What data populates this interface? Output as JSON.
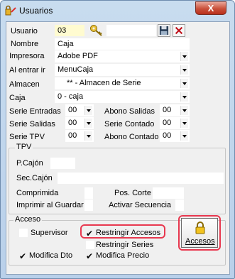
{
  "window": {
    "title": "Usuarios",
    "close_glyph": "X"
  },
  "top": {
    "usuario_label": "Usuario",
    "usuario_value": "03",
    "nombre_label": "Nombre",
    "nombre_value": "Caja",
    "impresora_label": "Impresora",
    "impresora_value": "Adobe PDF",
    "alentrar_label": "Al entrar ir",
    "alentrar_value": "MenuCaja",
    "almacen_label": "Almacen",
    "almacen_value": "** - Almacen de Serie",
    "caja_label": "Caja",
    "caja_value": "0 - caja"
  },
  "series": {
    "entradas_label": "Serie Entradas",
    "entradas_value": "00",
    "abono_salidas_label": "Abono Salidas",
    "abono_salidas_value": "00",
    "salidas_label": "Serie Salidas",
    "salidas_value": "00",
    "contado_label": "Serie Contado",
    "contado_value": "00",
    "tpv_label": "Serie TPV",
    "tpv_value": "00",
    "abono_contado_label": "Abono Contado",
    "abono_contado_value": "00"
  },
  "tpv": {
    "group_title": "TPV",
    "pcajon_label": "P.Cajón",
    "seccajon_label": "Sec.Cajón",
    "comprimida_label": "Comprimida",
    "pos_corte_label": "Pos. Corte",
    "imprimir_label": "Imprimir al Guardar",
    "activar_label": "Activar Secuencia"
  },
  "acceso": {
    "group_title": "Acceso",
    "supervisor_label": "Supervisor",
    "restringir_accesos_label": "Restringir Accesos",
    "restringir_series_label": "Restringir Series",
    "modifica_dto_label": "Modifica Dto",
    "modifica_precio_label": "Modifica Precio",
    "accesos_button_label": "Accesos",
    "check_glyph": "✔"
  },
  "colors": {
    "highlight": "#e8384f",
    "usuario_field_bg": "#fffbd0"
  }
}
